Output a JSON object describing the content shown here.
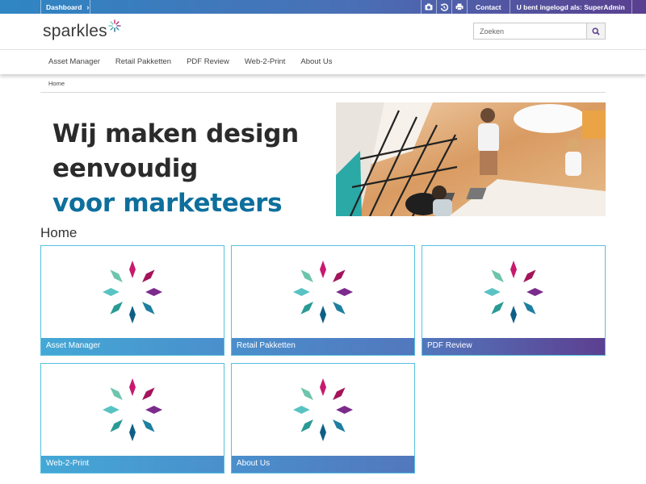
{
  "topbar": {
    "dashboard_label": "Dashboard",
    "contact_label": "Contact",
    "login_prefix": "U bent ingelogd als:",
    "login_user": "SuperAdmin",
    "tool_icons": [
      "camera-icon",
      "history-icon",
      "printer-icon"
    ]
  },
  "header": {
    "logo_text": "sparkles",
    "search_placeholder": "Zoeken"
  },
  "nav": {
    "items": [
      "Asset Manager",
      "Retail Pakketten",
      "PDF Review",
      "Web-2-Print",
      "About Us"
    ]
  },
  "breadcrumb": [
    "Home"
  ],
  "banner": {
    "line1": "Wij maken design",
    "line2": "eenvoudig",
    "line3": "voor marketeers"
  },
  "page_title": "Home",
  "tiles": [
    {
      "label": "Asset Manager"
    },
    {
      "label": "Retail Pakketten"
    },
    {
      "label": "PDF Review"
    },
    {
      "label": "Web-2-Print"
    },
    {
      "label": "About Us"
    }
  ],
  "colors": {
    "brand_blue": "#2f86c3",
    "brand_purple": "#5a3f8f",
    "tile_border": "#57bfde",
    "accent_text": "#0e6f9c"
  }
}
